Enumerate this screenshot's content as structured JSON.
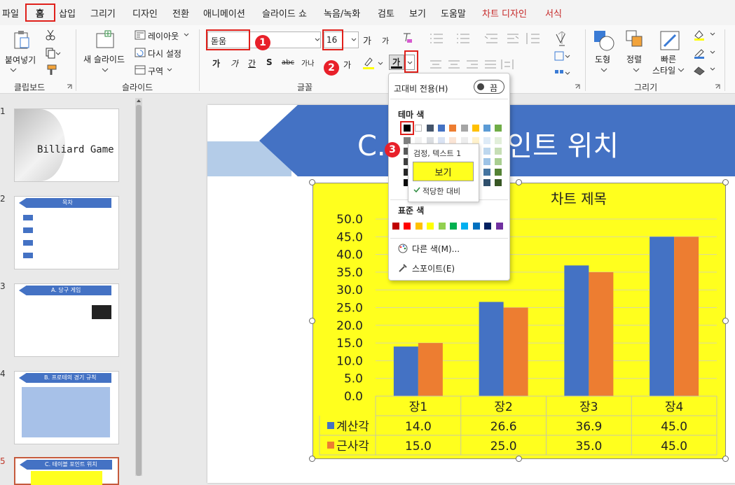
{
  "menu": {
    "items": [
      "파일",
      "홈",
      "삽입",
      "그리기",
      "디자인",
      "전환",
      "애니메이션",
      "슬라이드 쇼",
      "녹음/녹화",
      "검토",
      "보기",
      "도움말",
      "차트 디자인",
      "서식"
    ]
  },
  "ribbon": {
    "clipboard": {
      "paste": "붙여넣기",
      "group": "클립보드"
    },
    "slides": {
      "new_slide": "새 슬라이드",
      "layout": "레이아웃",
      "reset": "다시 설정",
      "section": "구역",
      "group": "슬라이드"
    },
    "font": {
      "font_name": "돋움",
      "font_size": "16",
      "bold_glyph": "가",
      "italic_glyph": "가",
      "underline_glyph": "간",
      "shadow_glyph": "S",
      "strike_glyph": "abc",
      "spacing_glyph": "가나",
      "case_glyph": "가",
      "grow_glyph": "가",
      "shrink_glyph": "가",
      "color_glyph": "가",
      "group": "글꼴"
    },
    "paragraph": {},
    "drawing": {
      "shape": "도형",
      "arrange": "정렬",
      "quick_style": "빠른",
      "quick_style2": "스타일",
      "group": "그리기"
    }
  },
  "badges": [
    "1",
    "2",
    "3"
  ],
  "colors": {
    "accent_red": "#e0201b",
    "chart_bg": "#ffff1e",
    "series1": "#4472c4",
    "series2": "#ed7d31",
    "slide_title_bg": "#4472c4"
  },
  "slides": [
    {
      "num": "1",
      "title": "Billiard Game"
    },
    {
      "num": "2",
      "title": "목차"
    },
    {
      "num": "3",
      "title": "A. 당구 게임"
    },
    {
      "num": "4",
      "title": "B. 프로테의 경기 규칙"
    },
    {
      "num": "5",
      "title": "C. 테이블 포인트 위치"
    }
  ],
  "slide_title": "C. 테이블 포인트 위치",
  "popup": {
    "contrast_label": "고대비 전용(H)",
    "toggle_label": "끔",
    "theme_label": "테마 색",
    "standard_label": "표준 색",
    "more_colors": "다른 색(M)...",
    "eyedropper": "스포이트(E)",
    "theme_top": [
      "#000000",
      "#ffffff",
      "#44546a",
      "#4472c4",
      "#ed7d31",
      "#a5a5a5",
      "#ffc000",
      "#5b9bd5",
      "#70ad47"
    ],
    "standard": [
      "#c00000",
      "#ff0000",
      "#ffc000",
      "#ffff00",
      "#92d050",
      "#00b050",
      "#00b0f0",
      "#0070c0",
      "#002060",
      "#7030a0"
    ]
  },
  "tooltip": {
    "name": "검정, 텍스트 1",
    "sample": "보기",
    "contrast": "적당한 대비"
  },
  "chart_data": {
    "type": "bar",
    "title": "차트 제목",
    "categories": [
      "장1",
      "장2",
      "장3",
      "장4"
    ],
    "series": [
      {
        "name": "계산각",
        "values": [
          14.0,
          26.6,
          36.9,
          45.0
        ]
      },
      {
        "name": "근사각",
        "values": [
          15.0,
          25.0,
          35.0,
          45.0
        ]
      }
    ],
    "ylim": [
      0,
      50
    ],
    "yticks": [
      "0.0",
      "5.0",
      "10.0",
      "15.0",
      "20.0",
      "25.0",
      "30.0",
      "35.0",
      "40.0",
      "45.0",
      "50.0"
    ],
    "table": [
      [
        "14.0",
        "26.6",
        "36.9",
        "45.0"
      ],
      [
        "15.0",
        "25.0",
        "35.0",
        "45.0"
      ]
    ],
    "grid": true,
    "legend": "data-table"
  }
}
